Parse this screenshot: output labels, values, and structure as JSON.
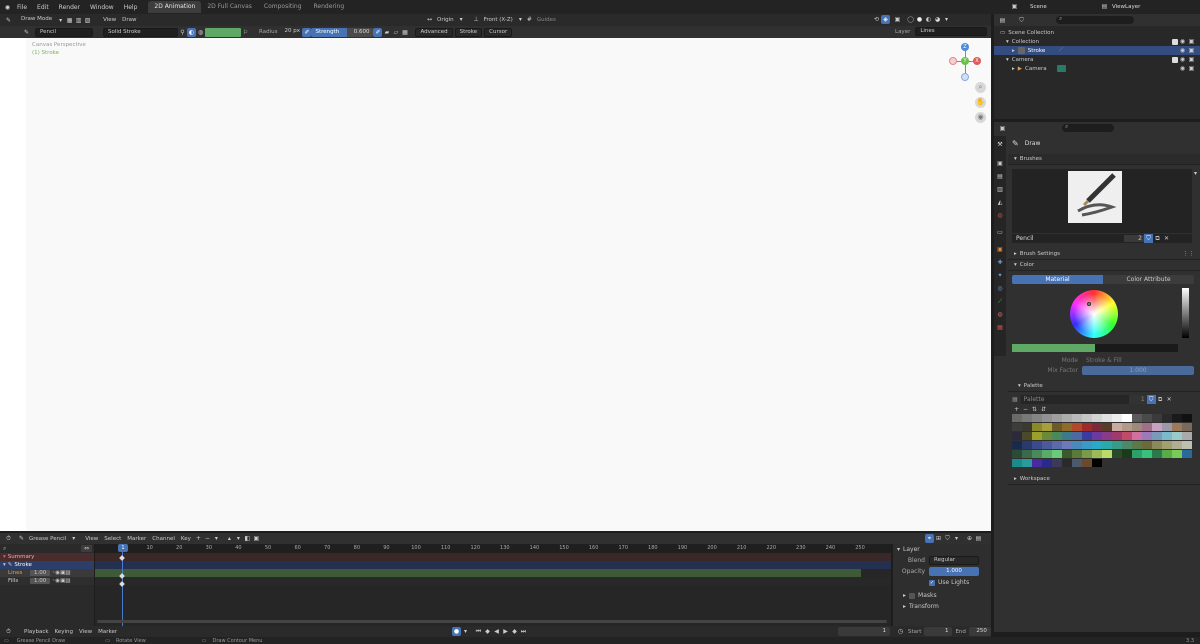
{
  "topbar": {
    "menus": [
      "File",
      "Edit",
      "Render",
      "Window",
      "Help"
    ],
    "workspaces": [
      "2D Animation",
      "2D Full Canvas",
      "Compositing",
      "Rendering"
    ],
    "active_workspace": "2D Animation",
    "scene": "Scene",
    "viewlayer": "ViewLayer"
  },
  "viewport_header": {
    "mode": "Draw Mode",
    "menus": [
      "View",
      "Draw"
    ],
    "origin": "Origin",
    "view": "Front (X-Z)",
    "guides": "Guides"
  },
  "tool_header": {
    "brush": "Pencil",
    "material": "Solid Stroke",
    "radius_label": "Radius",
    "radius_value": "20 px",
    "strength_label": "Strength",
    "strength_value": "0.600",
    "advanced": "Advanced",
    "stroke": "Stroke",
    "cursor": "Cursor",
    "layer_label": "Layer",
    "layer_value": "Lines",
    "color_hex": "#5fa866"
  },
  "viewport": {
    "overlay_title": "Canvas Perspective",
    "overlay_sub": "(1) Stroke",
    "navigator": {
      "z": "Z",
      "y": "Y",
      "x": "X"
    }
  },
  "tools": [
    "cursor-tool",
    "draw-tool",
    "fill-tool",
    "erase-tool",
    "tint-tool",
    "cutter-tool",
    "eyedropper-tool",
    "line-tool",
    "polyline-tool",
    "arc-tool",
    "curve-tool",
    "box-tool",
    "circle-tool",
    "interpolate-tool",
    "annotate-tool"
  ],
  "outliner": {
    "search_placeholder": "",
    "items": [
      {
        "label": "Scene Collection",
        "indent": 0
      },
      {
        "label": "Collection",
        "indent": 1
      },
      {
        "label": "Stroke",
        "indent": 2,
        "selected": true
      },
      {
        "label": "Camera",
        "indent": 1
      },
      {
        "label": "Camera",
        "indent": 2
      }
    ]
  },
  "properties": {
    "tool_name": "Draw",
    "brushes_section": "Brushes",
    "brush_name": "Pencil",
    "brush_users": "2",
    "brush_settings": "Brush Settings",
    "color_section": "Color",
    "color_tabs": [
      "Material",
      "Color Attribute"
    ],
    "mode_label": "Mode",
    "mode_value": "Stroke & Fill",
    "mix_factor_label": "Mix Factor",
    "mix_factor_value": "1.000",
    "palette_section": "Palette",
    "palette_name": "Palette",
    "palette_users": "1",
    "workspace_section": "Workspace"
  },
  "palette_colors": [
    [
      "#6a6a6a",
      "#787878",
      "#858585",
      "#929292",
      "#9f9f9f",
      "#acacac",
      "#b9b9b9",
      "#c6c6c6",
      "#d3d3d3",
      "#e0e0e0",
      "#ededed",
      "#ffffff",
      "#5a5a5a",
      "#4a4a4a",
      "#3a3a3a",
      "#2a2a2a",
      "#1a1a1a",
      "#111111"
    ],
    [
      "#3d3d3d",
      "#3c3a2e",
      "#8a8a2b",
      "#a89f3a",
      "#6d5a2a",
      "#8f6a2b",
      "#b24a2a",
      "#9e2a2a",
      "#7a2a3a",
      "#5a3a2a",
      "#c9a9a0",
      "#b49a8a",
      "#9e8a7a",
      "#a0708a",
      "#c8a0c0",
      "#9a9aaa",
      "#9a7a5a",
      "#7a6a5a"
    ],
    [
      "#2a2a3a",
      "#4a4a2a",
      "#9aa02a",
      "#6a8a3a",
      "#4a8a5a",
      "#3a7a8a",
      "#4a6aa0",
      "#3a3aa0",
      "#6a3aa0",
      "#8a3a8a",
      "#a03a6a",
      "#c04a6a",
      "#d070a0",
      "#9a7aba",
      "#7a9aba",
      "#7abaca",
      "#9acaca",
      "#aaaaaa"
    ],
    [
      "#1a2a4a",
      "#2a3a6a",
      "#3a4a8a",
      "#4a5a9a",
      "#5a6aaa",
      "#6a7aba",
      "#4a8aba",
      "#3a9aca",
      "#2aaaca",
      "#2aaaaa",
      "#3a9a8a",
      "#4a8a6a",
      "#5a7a4a",
      "#6a6a3a",
      "#8a8a5a",
      "#a0a070",
      "#b0b090",
      "#c0c0b0"
    ],
    [
      "#2a4a3a",
      "#3a6a4a",
      "#4a8a5a",
      "#5aaa6a",
      "#6aca7a",
      "#3a5a2a",
      "#5a7a3a",
      "#7a9a4a",
      "#9aba5a",
      "#bada6a",
      "#2a4a2a",
      "#1a3a1a",
      "#2aa06a",
      "#3ac07a",
      "#2a7a4a",
      "#5aaa4a",
      "#7aca5a",
      "#2a6a9a"
    ],
    [
      "#1a8a8a",
      "#2a9a9a",
      "#4a2aa0",
      "#2a2a8a",
      "#3a3a5a",
      "#2a2a2a",
      "#4a5a6a",
      "#6a4a2a",
      "#000000"
    ]
  ],
  "dopesheet": {
    "mode": "Grease Pencil",
    "menus": [
      "View",
      "Select",
      "Marker",
      "Channel",
      "Key"
    ],
    "frames": [
      "1",
      "10",
      "20",
      "30",
      "40",
      "50",
      "60",
      "70",
      "80",
      "90",
      "100",
      "110",
      "120",
      "130",
      "140",
      "150",
      "160",
      "170",
      "180",
      "190",
      "200",
      "210",
      "220",
      "230",
      "240",
      "250"
    ],
    "current_frame": "1",
    "channels": [
      {
        "label": "Summary",
        "kind": "summary"
      },
      {
        "label": "Stroke",
        "kind": "object"
      },
      {
        "label": "Lines",
        "value": "1.00",
        "kind": "layer"
      },
      {
        "label": "Fills",
        "value": "1.00",
        "kind": "layer"
      }
    ]
  },
  "layer_panel": {
    "title": "Layer",
    "blend_label": "Blend",
    "blend_value": "Regular",
    "opacity_label": "Opacity",
    "opacity_value": "1.000",
    "use_lights": "Use Lights",
    "masks": "Masks",
    "transform": "Transform"
  },
  "timeline": {
    "menus": [
      "Playback",
      "Keying",
      "View",
      "Marker"
    ],
    "frame": "1",
    "start_label": "Start",
    "start": "1",
    "end_label": "End",
    "end": "250"
  },
  "statusbar": {
    "items": [
      "Grease Pencil Draw",
      "Rotate View",
      "Draw Contour Menu"
    ],
    "version": "3.3"
  }
}
